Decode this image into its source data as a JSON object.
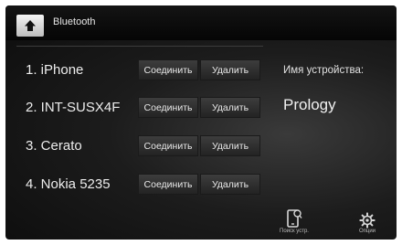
{
  "header": {
    "title": "Bluetooth",
    "home_icon": "home-icon"
  },
  "devices": [
    {
      "name": "1. iPhone",
      "connect_label": "Соединить",
      "delete_label": "Удалить"
    },
    {
      "name": "2. INT-SUSX4F",
      "connect_label": "Соединить",
      "delete_label": "Удалить"
    },
    {
      "name": "3. Cerato",
      "connect_label": "Соединить",
      "delete_label": "Удалить"
    },
    {
      "name": "4. Nokia 5235",
      "connect_label": "Соединить",
      "delete_label": "Удалить"
    }
  ],
  "device_info": {
    "label": "Имя устройства:",
    "value": "Prology"
  },
  "bottom": {
    "search_label": "Поиск устр.",
    "search_icon": "phone-search-icon",
    "options_label": "Опции",
    "options_icon": "gear-icon"
  },
  "colors": {
    "background": "#111111",
    "button": "#2e2e2e",
    "text": "#ededed"
  }
}
